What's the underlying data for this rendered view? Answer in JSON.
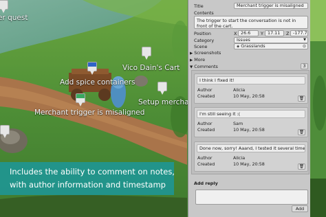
{
  "scene": {
    "labels": {
      "quest": "er quest",
      "cart_name": "Vico Dain's Cart",
      "spice": "Add spice containers",
      "setup": "Setup merchant",
      "trigger": "Merchant trigger is misaligned"
    },
    "caption": {
      "line1": "Includes the ability to comment on notes,",
      "line2": "with author information and timestamp"
    }
  },
  "inspector": {
    "title_label": "Title",
    "title_value": "Merchant trigger is misalig​ned",
    "contents_label": "Contents",
    "contents_value": "The trigger to start the conversation is not in front of the cart.",
    "position_label": "Position",
    "position": {
      "x_label": "X",
      "x": "26.6",
      "y_label": "Y",
      "y": "17.11",
      "z_label": "Z",
      "z": "-177.72"
    },
    "category_label": "Category",
    "category_value": "Issues",
    "scene_label": "Scene",
    "scene_value": "Grasslands",
    "screenshots_label": "Screenshots",
    "more_label": "More",
    "comments_label": "Comments",
    "comments_count": "3",
    "comments": [
      {
        "text": "I think I fixed it!",
        "author_label": "Author",
        "author": "Alicia",
        "created_label": "Created",
        "created": "10 May, 20:58"
      },
      {
        "text": "I'm still seeing it :(",
        "author_label": "Author",
        "author": "Sam",
        "created_label": "Created",
        "created": "10 May, 20:58"
      },
      {
        "text": "Done now, sorry! Aaand, I tested it several times.",
        "author_label": "Author",
        "author": "Alicia",
        "created_label": "Created",
        "created": "10 May, 20:58"
      }
    ],
    "add_reply_label": "Add reply",
    "add_button": "Add"
  },
  "colors": {
    "caption_bg": "#1e9696",
    "panel_bg": "#c8c8c8",
    "pin_white": "#e6e6e6",
    "pin_blue": "#2f63c8",
    "pin_green": "#3aa860"
  }
}
